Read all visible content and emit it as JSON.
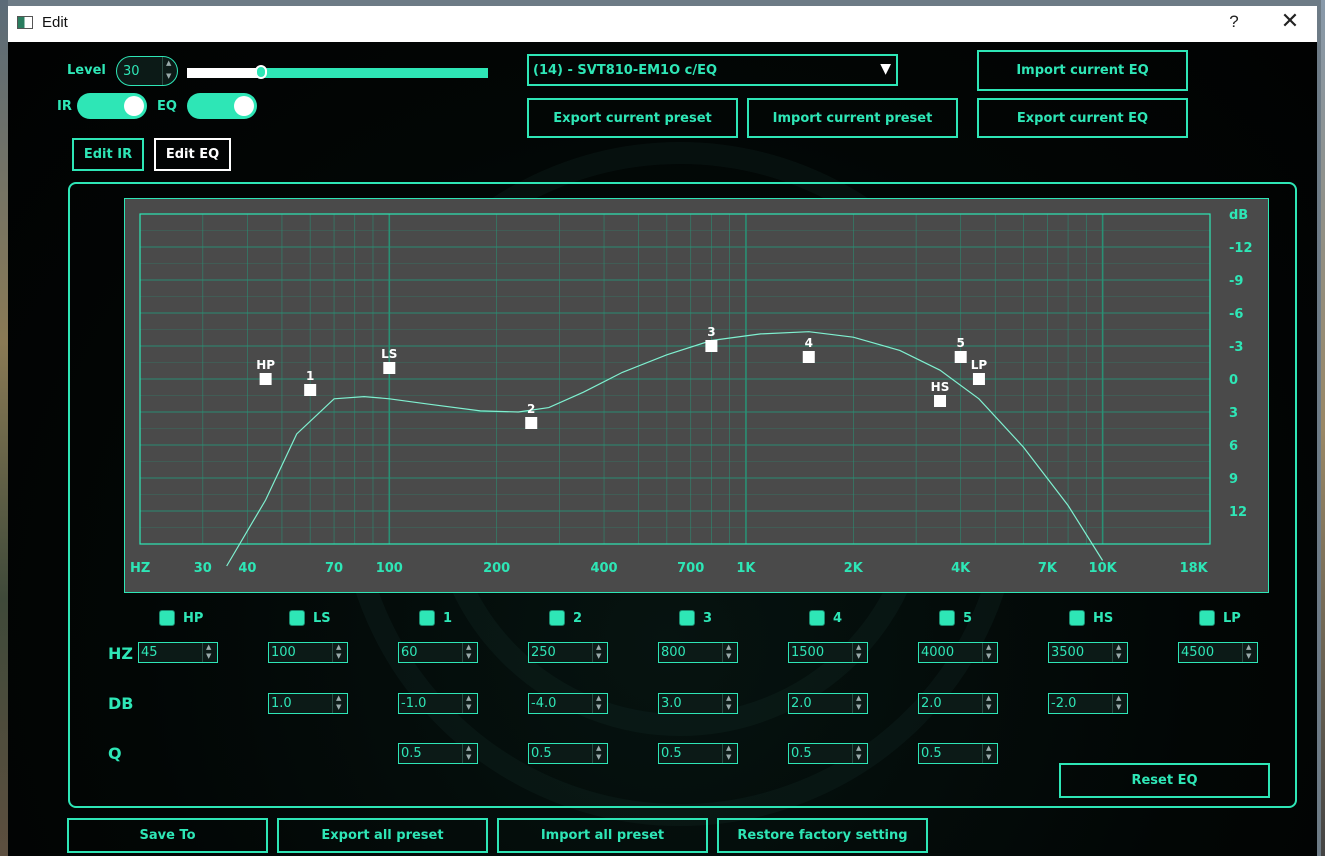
{
  "window": {
    "title": "Edit",
    "help_label": "?",
    "close_label": "✕"
  },
  "top": {
    "level_label": "Level",
    "level_value": "30",
    "level_slider_fraction": 0.247,
    "ir_label": "IR",
    "eq_label": "EQ",
    "ir_on": true,
    "eq_on": true,
    "preset_select": "(14) - SVT810-EM1O c/EQ",
    "export_current_preset": "Export current preset",
    "import_current_preset": "Import current preset",
    "import_current_eq": "Import current EQ",
    "export_current_eq": "Export current EQ",
    "edit_ir": "Edit IR",
    "edit_eq": "Edit EQ"
  },
  "graph": {
    "x_label": "HZ",
    "x_ticks": [
      "30",
      "40",
      "70",
      "100",
      "200",
      "400",
      "700",
      "1K",
      "2K",
      "4K",
      "7K",
      "10K",
      "18K"
    ],
    "y_unit": "dB",
    "y_ticks": [
      "-12",
      "-9",
      "-6",
      "-3",
      "0",
      "3",
      "6",
      "9",
      "12"
    ],
    "points": [
      {
        "id": "HP",
        "hz": 45,
        "db": 0
      },
      {
        "id": "1",
        "hz": 60,
        "db": -1.0
      },
      {
        "id": "LS",
        "hz": 100,
        "db": 1.0
      },
      {
        "id": "2",
        "hz": 250,
        "db": -4.0
      },
      {
        "id": "3",
        "hz": 800,
        "db": 3.0
      },
      {
        "id": "4",
        "hz": 1500,
        "db": 2.0
      },
      {
        "id": "5",
        "hz": 4000,
        "db": 2.0
      },
      {
        "id": "LP",
        "hz": 4500,
        "db": 0
      },
      {
        "id": "HS",
        "hz": 3500,
        "db": -2.0
      }
    ]
  },
  "bands": {
    "row_labels": {
      "hz": "HZ",
      "db": "DB",
      "q": "Q"
    },
    "columns": [
      {
        "name": "HP",
        "hz": "45",
        "db": null,
        "q": null
      },
      {
        "name": "LS",
        "hz": "100",
        "db": "1.0",
        "q": null
      },
      {
        "name": "1",
        "hz": "60",
        "db": "-1.0",
        "q": "0.5"
      },
      {
        "name": "2",
        "hz": "250",
        "db": "-4.0",
        "q": "0.5"
      },
      {
        "name": "3",
        "hz": "800",
        "db": "3.0",
        "q": "0.5"
      },
      {
        "name": "4",
        "hz": "1500",
        "db": "2.0",
        "q": "0.5"
      },
      {
        "name": "5",
        "hz": "4000",
        "db": "2.0",
        "q": "0.5"
      },
      {
        "name": "HS",
        "hz": "3500",
        "db": "-2.0",
        "q": null
      },
      {
        "name": "LP",
        "hz": "4500",
        "db": null,
        "q": null
      }
    ]
  },
  "buttons": {
    "reset_eq": "Reset EQ",
    "save_to": "Save To",
    "export_all": "Export all preset",
    "import_all": "Import all preset",
    "restore": "Restore factory setting"
  },
  "colors": {
    "accent": "#2ee6b6",
    "graph_bg": "#4a4a4a"
  }
}
